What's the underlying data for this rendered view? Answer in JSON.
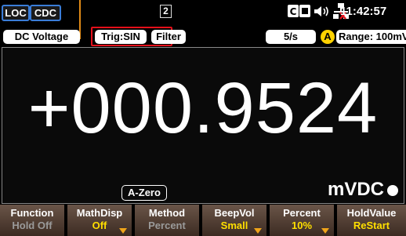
{
  "status": {
    "loc_label": "LOC",
    "cdc_label": "CDC",
    "page_number": "2",
    "time": "11:42:57"
  },
  "measure_bar": {
    "function": "DC Voltage",
    "trigger": "Trig:SIN",
    "filter": "Filter",
    "rate": "5/s",
    "auto_icon": "A",
    "range": "Range: 100mV"
  },
  "display": {
    "reading": "+000.9524",
    "azero": "A-Zero",
    "unit": "mVDC"
  },
  "softkeys": [
    {
      "label": "Function",
      "value": "Hold Off"
    },
    {
      "label": "MathDisp",
      "value": "Off"
    },
    {
      "label": "Method",
      "value": "Percent"
    },
    {
      "label": "BeepVol",
      "value": "Small"
    },
    {
      "label": "Percent",
      "value": "10%"
    },
    {
      "label": "HoldValue",
      "value": "ReStart"
    }
  ],
  "colors": {
    "accent_blue": "#3a7dd8",
    "highlight_red": "#e5101a",
    "softkey_value": "#ffdf00",
    "annotation": "#e08a17"
  }
}
